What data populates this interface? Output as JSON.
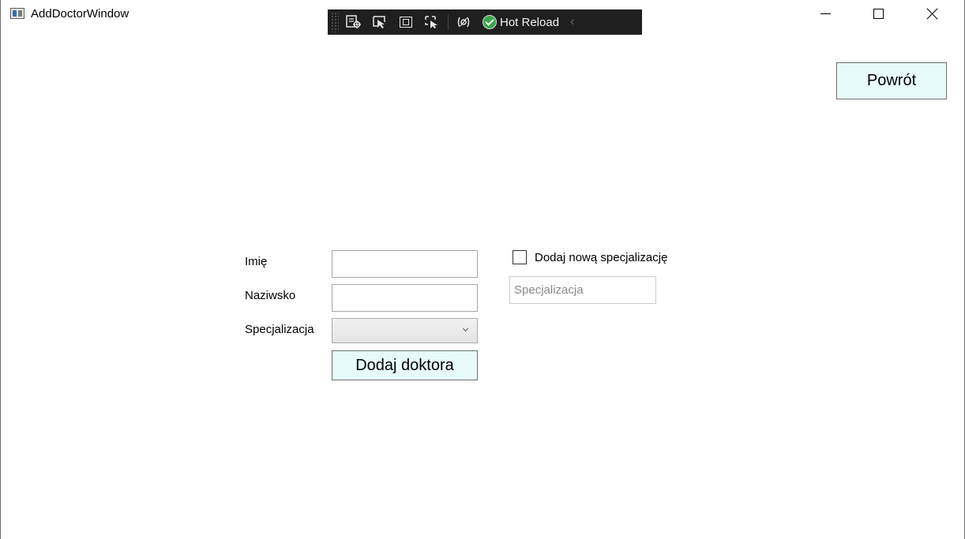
{
  "window": {
    "title": "AddDoctorWindow",
    "controls": {
      "minimize": "minimize-icon",
      "maximize": "maximize-icon",
      "close": "close-icon"
    }
  },
  "debug_toolbar": {
    "hot_reload_label": "Hot Reload",
    "collapse_glyph": "‹"
  },
  "header": {
    "back_label": "Powrót"
  },
  "form": {
    "first_name_label": "Imię",
    "last_name_label": "Naziwsko",
    "specialization_label": "Specjalizacja",
    "first_name_value": "",
    "last_name_value": "",
    "specialization_selected": "",
    "submit_label": "Dodaj doktora",
    "new_specialization_checkbox_label": "Dodaj nową specjalizację",
    "new_specialization_checked": false,
    "new_specialization_placeholder": "Specjalizacja"
  },
  "colors": {
    "button_bg": "#e8fbfb",
    "toolbar_bg": "#1f1f1f",
    "hot_reload_ok": "#3aa64a"
  }
}
